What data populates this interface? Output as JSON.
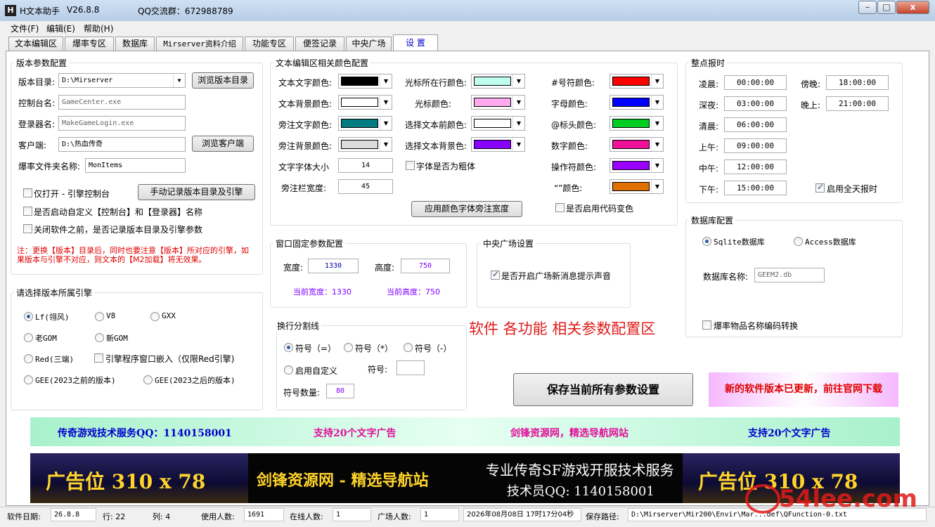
{
  "window": {
    "app_name": "H文本助手",
    "version": "V26.8.8",
    "qq_group": "QQ交流群：672988789",
    "minimize": "–",
    "maximize": "□",
    "close": "x"
  },
  "menu": [
    "文件(F)",
    "编辑(E)",
    "帮助(H)"
  ],
  "tabs": [
    "文本编辑区",
    "爆率专区",
    "数据库",
    "Mirserver资料介绍",
    "功能专区",
    "便签记录",
    "中央广场",
    "设  置"
  ],
  "active_tab": 7,
  "version_config": {
    "title": "版本参数配置",
    "dir_label": "版本目录:",
    "dir_value": "D:\\Mirserver",
    "browse_dir": "浏览版本目录",
    "console_label": "控制台名:",
    "console_value": "GameCenter.exe",
    "login_label": "登录器名:",
    "login_value": "MakeGameLogin.exe",
    "client_label": "客户端:",
    "client_value": "D:\\热血传奇",
    "browse_client": "浏览客户端",
    "drop_label": "爆率文件夹名称:",
    "drop_value": "MonItems",
    "only_open": "仅打开 - 引擎控制台",
    "manual_record": "手动记录版本目录及引擎",
    "custom_names": "是否启动自定义【控制台】和【登录器】名称",
    "record_on_close": "关闭软件之前，是否记录版本目录及引擎参数",
    "note": "注：更换【版本】目录后，同时也要注意【版本】所对应的引擎，如果版本与引擎不对应，则文本的【M2加载】将无效果。"
  },
  "engine": {
    "title": "请选择版本所属引擎",
    "options": [
      "Lf(翎风)",
      "V8",
      "GXX",
      "老GOM",
      "新GOM",
      "Red(三端)",
      "GEE(2023之前的版本)",
      "GEE(2023之后的版本)"
    ],
    "selected": 0,
    "embed": "引擎程序窗口嵌入（仅限Red引擎)"
  },
  "colors": {
    "title": "文本编辑区相关颜色配置",
    "text_color": "文本文字颜色:",
    "text_bg": "文本背景颜色:",
    "note_color": "旁注文字颜色:",
    "note_bg": "旁注背景颜色:",
    "font_size_label": "文字字体大小",
    "font_size": "14",
    "note_width_label": "旁注栏宽度:",
    "note_width": "45",
    "cursor_line": "光标所在行颜色:",
    "cursor": "光标颜色:",
    "sel_fg": "选择文本前颜色:",
    "sel_bg": "选择文本背景色:",
    "bold": "字体是否为粗体",
    "hash_color": "#号符颜色:",
    "letter_color": "字母颜色:",
    "at_color": "@标头颜色:",
    "digit_color": "数字颜色:",
    "op_color": "操作符颜色:",
    "quote_color": "“”颜色:",
    "code_color": "是否启用代码变色",
    "apply": "应用颜色字体旁注宽度",
    "swatches": {
      "text_color": "#000000",
      "text_bg": "#ffffff",
      "note_color": "#007b7f",
      "note_bg": "#dcdcdc",
      "cursor_line": "#bfffee",
      "cursor": "#ffaaee",
      "sel_fg": "#ffffff",
      "sel_bg": "#8800ff",
      "hash": "#ff0000",
      "letter": "#0000ff",
      "at": "#00cc22",
      "digit": "#f0109a",
      "op": "#9900ff",
      "quote": "#e07000"
    }
  },
  "window_size": {
    "title": "窗口固定参数配置",
    "width_label": "宽度:",
    "width": "1330",
    "height_label": "高度:",
    "height": "750",
    "current_width": "当前宽度：1330",
    "current_height": "当前高度：750"
  },
  "plaza": {
    "title": "中央广场设置",
    "sound": "是否开启广场新消息提示声音"
  },
  "separator": {
    "title": "换行分割线",
    "options": [
      "符号（=）",
      "符号（*）",
      "符号（-）"
    ],
    "custom": "启用自定义",
    "symbol_label": "符号:",
    "symbol_value": "",
    "count_label": "符号数量:",
    "count": "80"
  },
  "banner_caption": "软件 各功能 相关参数配置区",
  "hourly": {
    "title": "整点报时",
    "items": [
      {
        "label": "凌晨:",
        "time": "00:00:00"
      },
      {
        "label": "深夜:",
        "time": "03:00:00"
      },
      {
        "label": "清晨:",
        "time": "06:00:00"
      },
      {
        "label": "上午:",
        "time": "09:00:00"
      },
      {
        "label": "中午:",
        "time": "12:00:00"
      },
      {
        "label": "下午:",
        "time": "15:00:00"
      },
      {
        "label": "傍晚:",
        "time": "18:00:00"
      },
      {
        "label": "晚上:",
        "time": "21:00:00"
      }
    ],
    "all_day": "启用全天报时"
  },
  "database": {
    "title": "数据库配置",
    "sqlite": "Sqlite数据库",
    "access": "Access数据库",
    "name_label": "数据库名称:",
    "name_value": "GEEM2.db",
    "convert": "爆率物品名称编码转换"
  },
  "save_button": "保存当前所有参数设置",
  "update_notice": "新的软件版本已更新，前往官网下载",
  "ads": {
    "strip": [
      "传奇游戏技术服务QQ：1140158001",
      "支持20个文字广告",
      "剑锋资源网，精选导航网站",
      "支持20个文字广告"
    ],
    "big1": "广告位    310 x 78",
    "big2": "剑锋资源网 - 精选导航站",
    "big3_line1": "专业传奇SF游戏开服技术服务",
    "big3_line2": "技术员QQ: 1140158001",
    "big4": "广告位    310 x 78"
  },
  "status": {
    "date_label": "软件日期:",
    "date": "26.8.8",
    "row_label": "行: 22",
    "col_label": "列: 4",
    "users_label": "使用人数:",
    "users": "1691",
    "online_label": "在线人数:",
    "online": "1",
    "plaza_label": "广场人数:",
    "plaza": "1",
    "datetime": "2026年08月08日 17时17分04秒",
    "path_label": "保存路径:",
    "path": "D:\\Mirserver\\Mir200\\Envir\\Mar...def\\QFunction-0.txt"
  },
  "watermark": "54lee.com"
}
